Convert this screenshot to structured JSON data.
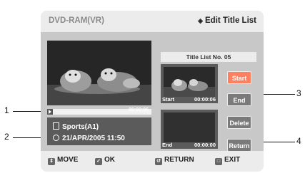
{
  "header": {
    "title_left": "DVD-RAM(VR)",
    "title_right": "Edit Title List",
    "title_right_icon": "diamond-icon"
  },
  "player": {
    "total_time": "00:00:06",
    "title_name": "Sports(A1)",
    "date_time": "21/APR/2005 11:50"
  },
  "title_list": {
    "label": "Title List No. 05",
    "start_label": "Start",
    "start_time": "00:00:06",
    "end_label": "End",
    "end_time": "00:00:00"
  },
  "buttons": {
    "start": "Start",
    "end": "End",
    "delete": "Delete",
    "return": "Return"
  },
  "footer": {
    "move": "MOVE",
    "ok": "OK",
    "return": "RETURN",
    "exit": "EXIT"
  },
  "callouts": [
    "1",
    "2",
    "3",
    "4"
  ],
  "colors": {
    "accent": "#ff7f5f",
    "panel": "#cfcfcf",
    "header": "#ececec"
  }
}
